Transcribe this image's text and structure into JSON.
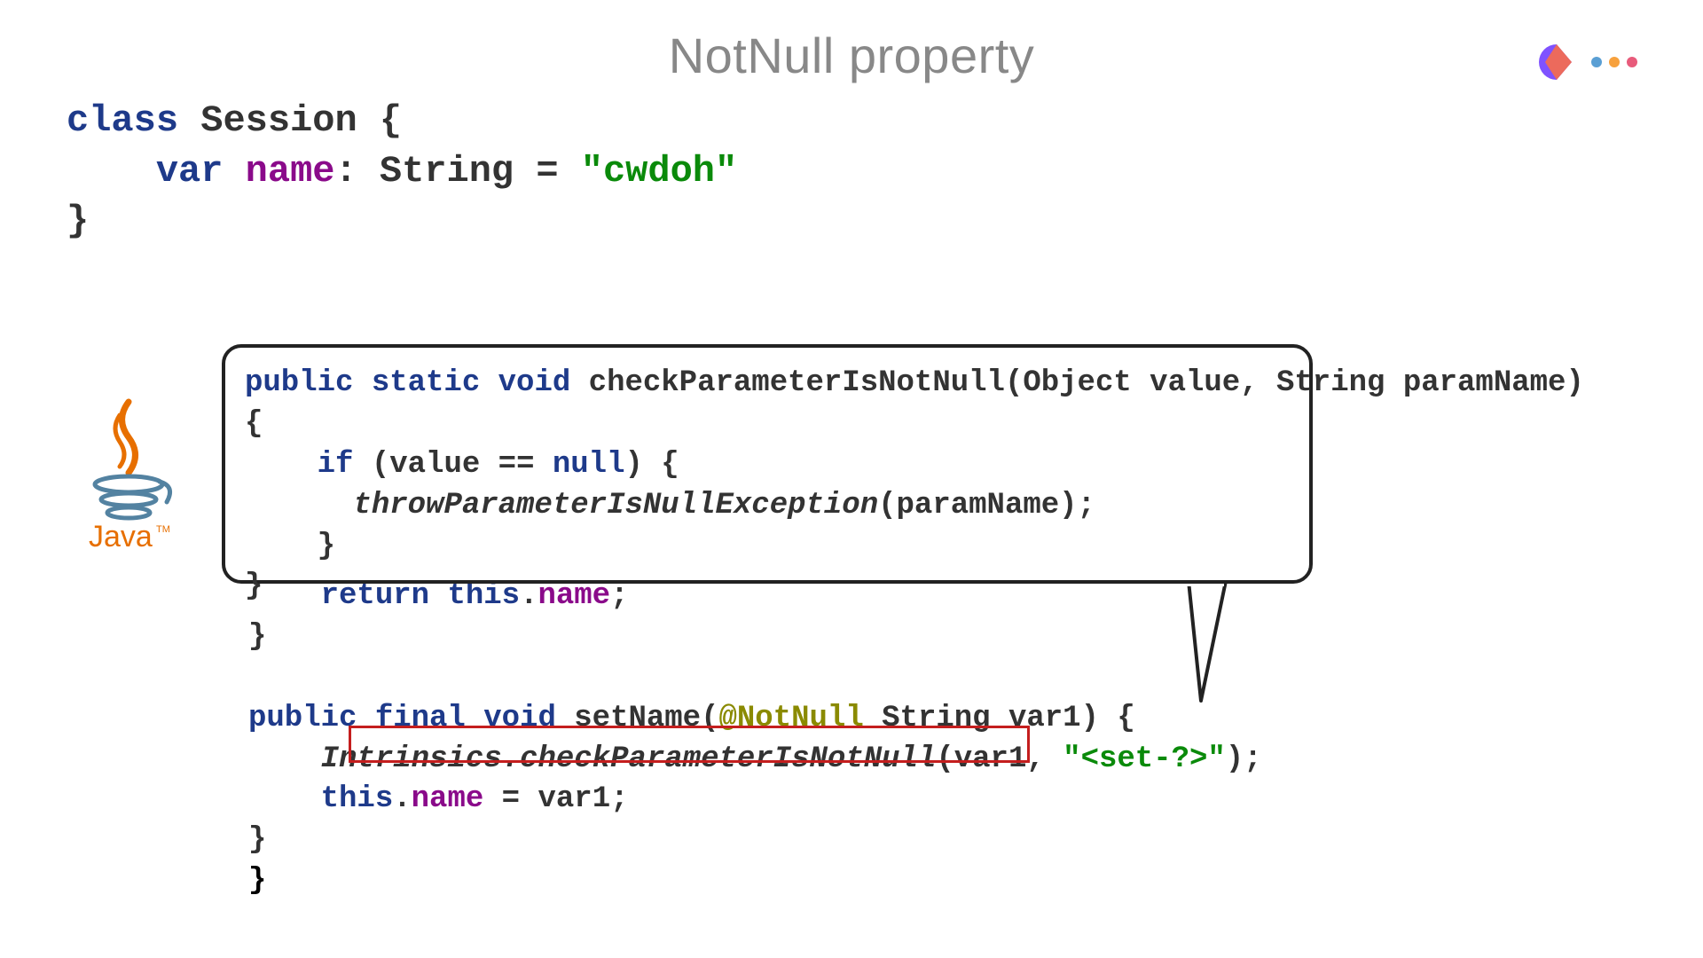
{
  "title": "NotNull property",
  "kotlin": {
    "line1_kw": "class",
    "line1_rest": " Session {",
    "line2_indent": "    ",
    "line2_var": "var",
    "line2_space1": " ",
    "line2_name": "name",
    "line2_post": ": String = ",
    "line2_str": "\"cwdoh\"",
    "line3": "}"
  },
  "callout": {
    "l1a": "public static void",
    "l1b": " checkParameterIsNotNull(Object value, String paramName)",
    "l2": "{",
    "l3_indent": "    ",
    "l3_if": "if",
    "l3_rest": " (value == ",
    "l3_null": "null",
    "l3_close": ") {",
    "l4_indent": "      ",
    "l4_call": "throwParameterIsNullException",
    "l4_args": "(paramName);",
    "l5": "    }",
    "l6": "}"
  },
  "java": {
    "l_ret_indent": "    ",
    "l_ret_kw": "return this",
    "l_ret_dot": ".",
    "l_ret_name": "name",
    "l_ret_semi": ";",
    "l_close1": "}",
    "l_blank": "",
    "l_set_kw": "public final void",
    "l_set_fn": " setName(",
    "l_set_anno": "@NotNull",
    "l_set_rest": " String var1) {",
    "l_intr_indent": "    ",
    "l_intr_call": "Intrinsics.checkParameterIsNotNull",
    "l_intr_args1": "(var1, ",
    "l_intr_str": "\"<set-?>\"",
    "l_intr_args2": ");",
    "l_assign_indent": "    ",
    "l_assign_this": "this",
    "l_assign_dot": ".",
    "l_assign_name": "name",
    "l_assign_rest": " = var1;",
    "l_close2": "}",
    "l_close_outer": "}"
  }
}
